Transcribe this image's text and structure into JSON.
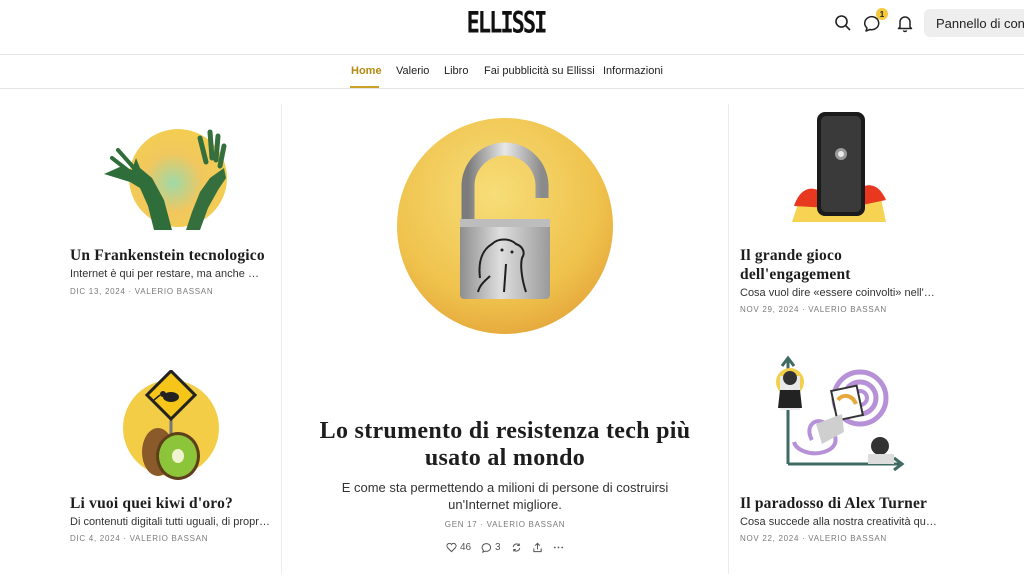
{
  "header": {
    "logo": "ELLISSI",
    "notification_count": "1",
    "dashboard_label": "Pannello di controllo"
  },
  "nav": {
    "items": [
      "Home",
      "Valerio",
      "Libro",
      "Fai pubblicità su Ellissi",
      "Informazioni"
    ]
  },
  "posts": {
    "left": [
      {
        "title": "Un Frankenstein tecnologico",
        "subtitle": "Internet è qui per restare, ma anche per...",
        "meta": "DIC 13, 2024 · VALERIO BASSAN"
      },
      {
        "title": "Li vuoi quei kiwi d'oro?",
        "subtitle": "Di contenuti digitali tutti uguali, di proprietà...",
        "meta": "DIC 4, 2024 · VALERIO BASSAN"
      }
    ],
    "featured": {
      "title": "Lo strumento di resistenza tech più usato al mondo",
      "subtitle": "E come sta permettendo a milioni di persone di costruirsi un'Internet migliore.",
      "meta": "GEN 17 · VALERIO BASSAN",
      "likes": "46",
      "comments": "3"
    },
    "right": [
      {
        "title": "Il grande gioco dell'engagement",
        "subtitle": "Cosa vuol dire «essere coinvolti» nell'era ...",
        "meta": "NOV 29, 2024 · VALERIO BASSAN"
      },
      {
        "title": "Il paradosso di Alex Turner",
        "subtitle": "Cosa succede alla nostra creatività quando...",
        "meta": "NOV 22, 2024 · VALERIO BASSAN"
      }
    ]
  },
  "icons": [
    "search-icon",
    "chat-icon",
    "bell-icon",
    "heart-icon",
    "comment-icon",
    "restack-icon",
    "share-icon",
    "more-icon"
  ],
  "colors": {
    "accent": "#c9a227",
    "illustration_yellow": "#f3cf5a"
  }
}
